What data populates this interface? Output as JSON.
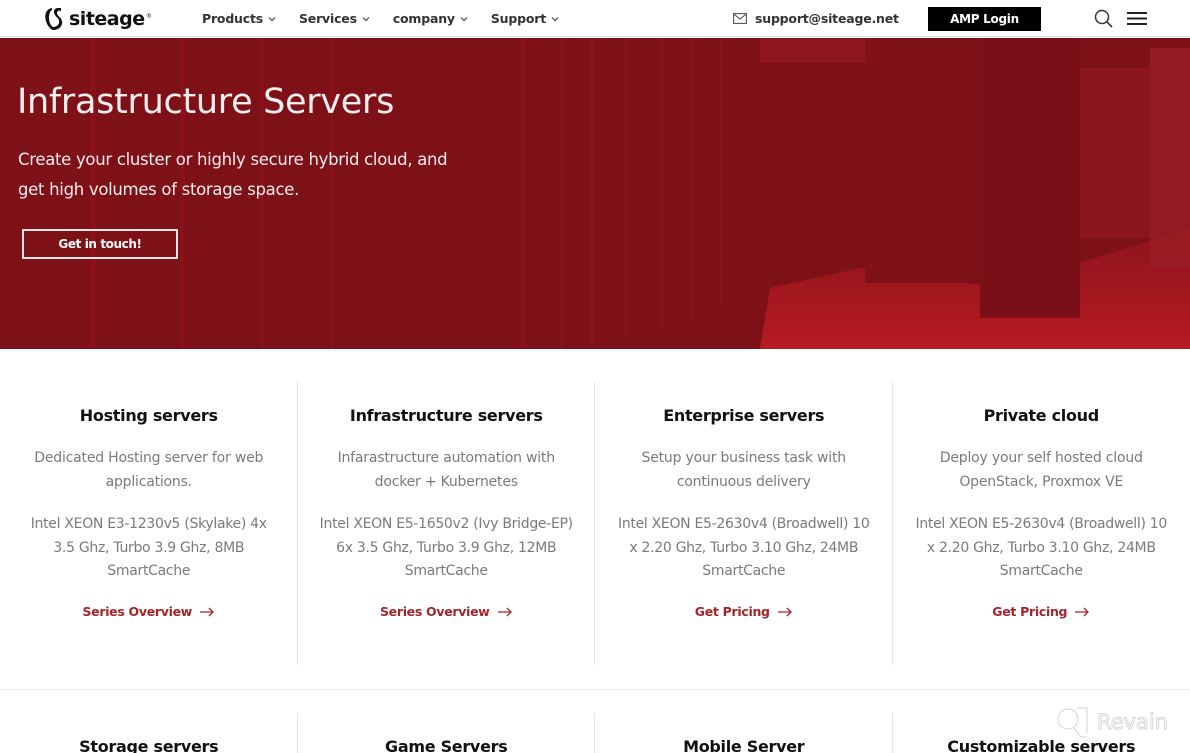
{
  "header": {
    "logo_text": "siteage",
    "logo_reg": "®",
    "nav": [
      {
        "label": "Products",
        "icon": "chevron-down-icon"
      },
      {
        "label": "Services",
        "icon": "chevron-down-icon"
      },
      {
        "label": "company",
        "icon": "chevron-down-icon"
      },
      {
        "label": "Support",
        "icon": "chevron-down-icon"
      }
    ],
    "support_email": "support@siteage.net",
    "amp_login_label": "AMP Login",
    "icons": {
      "mail": "mail-icon",
      "search": "search-icon",
      "menu": "hamburger-menu-icon"
    }
  },
  "hero": {
    "title": "Infrastructure Servers",
    "subtitle": "Create your cluster or highly secure hybrid cloud, and get high volumes of storage space.",
    "cta_label": "Get in touch!",
    "background_color": "#7e1018"
  },
  "cards": [
    {
      "title": "Hosting servers",
      "description": "Dedicated Hosting server for web applications.",
      "spec": "Intel XEON E3-1230v5 (Skylake)  4x 3.5 Ghz, Turbo 3.9 Ghz, 8MB SmartCache",
      "link_label": "Series Overview"
    },
    {
      "title": "Infrastructure servers",
      "description": "Infarastructure automation with docker + Kubernetes",
      "spec": "Intel XEON E5-1650v2 (Ivy Bridge-EP) 6x 3.5 Ghz, Turbo 3.9 Ghz, 12MB SmartCache",
      "link_label": "Series Overview"
    },
    {
      "title": "Enterprise servers",
      "description": "Setup your business task with continuous delivery",
      "spec": "Intel XEON E5-2630v4 (Broadwell) 10 x 2.20 Ghz, Turbo 3.10 Ghz, 24MB SmartCache",
      "link_label": "Get Pricing"
    },
    {
      "title": "Private cloud",
      "description": "Deploy your self hosted cloud OpenStack, Proxmox VE",
      "spec": "Intel XEON E5-2630v4 (Broadwell) 10 x 2.20 Ghz, Turbo 3.10 Ghz, 24MB SmartCache",
      "link_label": "Get Pricing"
    }
  ],
  "cards_row2": [
    {
      "title": "Storage servers"
    },
    {
      "title": "Game Servers"
    },
    {
      "title": "Mobile Server"
    },
    {
      "title": "Customizable servers"
    }
  ],
  "watermark": {
    "text": "Revain"
  },
  "colors": {
    "accent": "#a5242c",
    "hero": "#7e1018",
    "text_muted": "#7a7a7a"
  }
}
